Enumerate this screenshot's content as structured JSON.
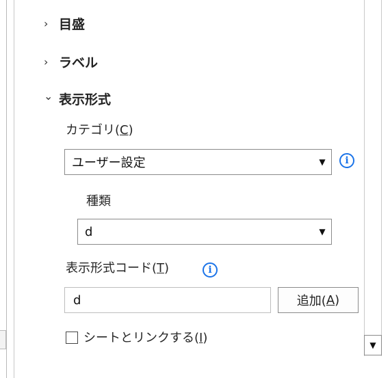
{
  "sections": {
    "axis": {
      "label": "目盛",
      "expanded": false,
      "chevron": "›"
    },
    "labels": {
      "label": "ラベル",
      "expanded": false,
      "chevron": "›"
    },
    "number_format": {
      "label": "表示形式",
      "expanded": true,
      "chevron": "⌄"
    }
  },
  "category": {
    "label_prefix": "カテゴリ(",
    "mnemonic": "C",
    "label_suffix": ")",
    "selected": "ユーザー設定"
  },
  "type": {
    "label": "種類",
    "selected": "d"
  },
  "format_code": {
    "label_prefix": "表示形式コード(",
    "mnemonic": "T",
    "label_suffix": ")",
    "value": "d",
    "add_prefix": "追加(",
    "add_mnemonic": "A",
    "add_suffix": ")"
  },
  "link_source": {
    "label_prefix": "シートとリンクする(",
    "mnemonic": "I",
    "label_suffix": ")",
    "checked": false
  },
  "icons": {
    "info": "i",
    "dropdown_arrow": "▼",
    "scroll_down_arrow": "▼"
  },
  "colors": {
    "info_blue": "#1a73e8"
  }
}
